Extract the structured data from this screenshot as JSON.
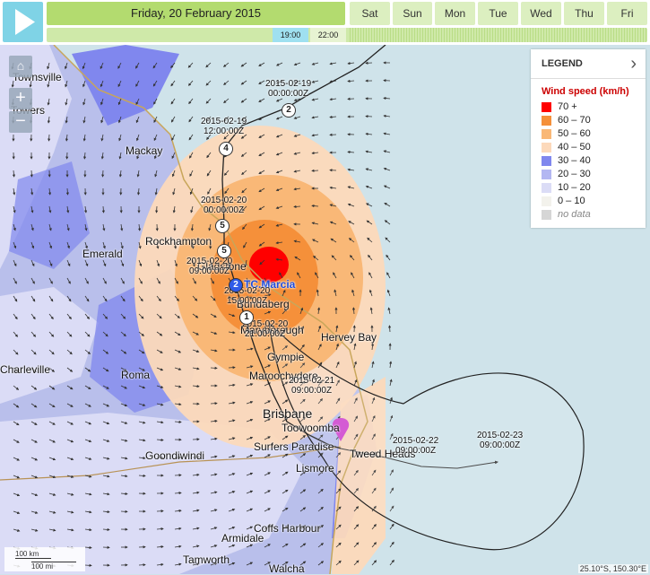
{
  "header": {
    "play_icon": "play-icon",
    "current_date": "Friday, 20 February 2015",
    "days": [
      "Sat",
      "Sun",
      "Mon",
      "Tue",
      "Wed",
      "Thu",
      "Fri"
    ],
    "times": [
      "19:00",
      "22:00"
    ]
  },
  "legend": {
    "header": "LEGEND",
    "title": "Wind speed (km/h)",
    "items": [
      {
        "label": "70 +",
        "color": "#ff0000"
      },
      {
        "label": "60 – 70",
        "color": "#f5903a"
      },
      {
        "label": "50 – 60",
        "color": "#f9b877"
      },
      {
        "label": "40 – 50",
        "color": "#fcd9bb"
      },
      {
        "label": "30 – 40",
        "color": "#8087ee"
      },
      {
        "label": "20 – 30",
        "color": "#b3b7f2"
      },
      {
        "label": "10 – 20",
        "color": "#dbdcf6"
      },
      {
        "label": "0 – 10",
        "color": "#f3f2ec"
      },
      {
        "label": "no data",
        "color": "#d6d6d6"
      }
    ]
  },
  "map": {
    "places": [
      "Townsville",
      "Towers",
      "Mackay",
      "Emerald",
      "Rockhampton",
      "Gladstone",
      "Bundaberg",
      "Maryborough",
      "Hervey Bay",
      "Gympie",
      "Maroochydore",
      "Brisbane",
      "Toowoomba",
      "Surfers Paradise",
      "Tweed Heads",
      "Lismore",
      "Goondiwindi",
      "Roma",
      "Charleville",
      "Coffs Harbour",
      "Armidale",
      "Tamworth",
      "Walcha"
    ],
    "storm_name": "TC.Marcia",
    "track_labels": [
      {
        "date": "2015-02-19",
        "time": "00:00:00Z"
      },
      {
        "date": "2015-02-19",
        "time": "12:00:00Z"
      },
      {
        "date": "2015-02-20",
        "time": "00:00:00Z"
      },
      {
        "date": "2015-02-20",
        "time": "09:00:00Z"
      },
      {
        "date": "2015-02-20",
        "time": "15:00:00Z"
      },
      {
        "date": "2015-02-20",
        "time": "21:00:00Z"
      },
      {
        "date": "2015-02-21",
        "time": "09:00:00Z"
      },
      {
        "date": "2015-02-22",
        "time": "09:00:00Z"
      },
      {
        "date": "2015-02-23",
        "time": "09:00:00Z"
      }
    ],
    "category_markers": [
      "2",
      "4",
      "5",
      "5",
      "2",
      "1"
    ],
    "scale": {
      "km": "100 km",
      "mi": "100 mi"
    },
    "coordinates": "25.10°S, 150.30°E"
  },
  "controls": {
    "zoom_in": "+",
    "zoom_out": "−",
    "home_icon": "home-icon",
    "legend_toggle_icon": "chevron-right-icon"
  }
}
